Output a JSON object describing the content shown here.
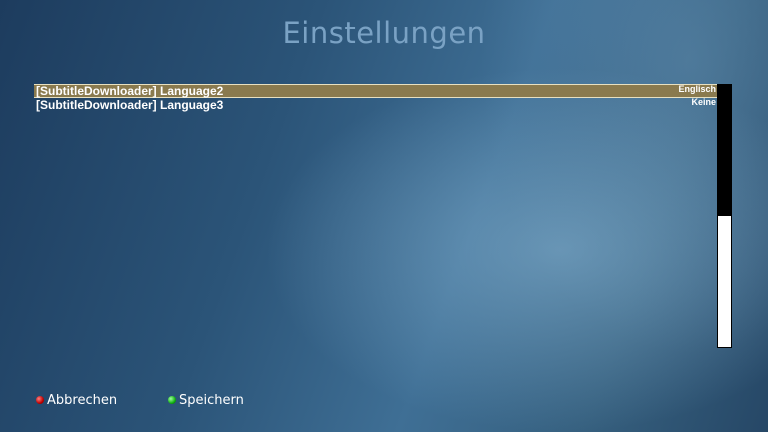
{
  "header": {
    "title": "Einstellungen"
  },
  "settings": {
    "items": [
      {
        "label": "[SubtitleDownloader] Language2",
        "value": "Englisch",
        "selected": true
      },
      {
        "label": "[SubtitleDownloader] Language3",
        "value": "Keine",
        "selected": false
      }
    ]
  },
  "scrollbar": {
    "visible_fraction": 0.5
  },
  "footer": {
    "red_button": {
      "label": "Abbrechen",
      "color": "#d00000"
    },
    "green_button": {
      "label": "Speichern",
      "color": "#10b010"
    }
  }
}
